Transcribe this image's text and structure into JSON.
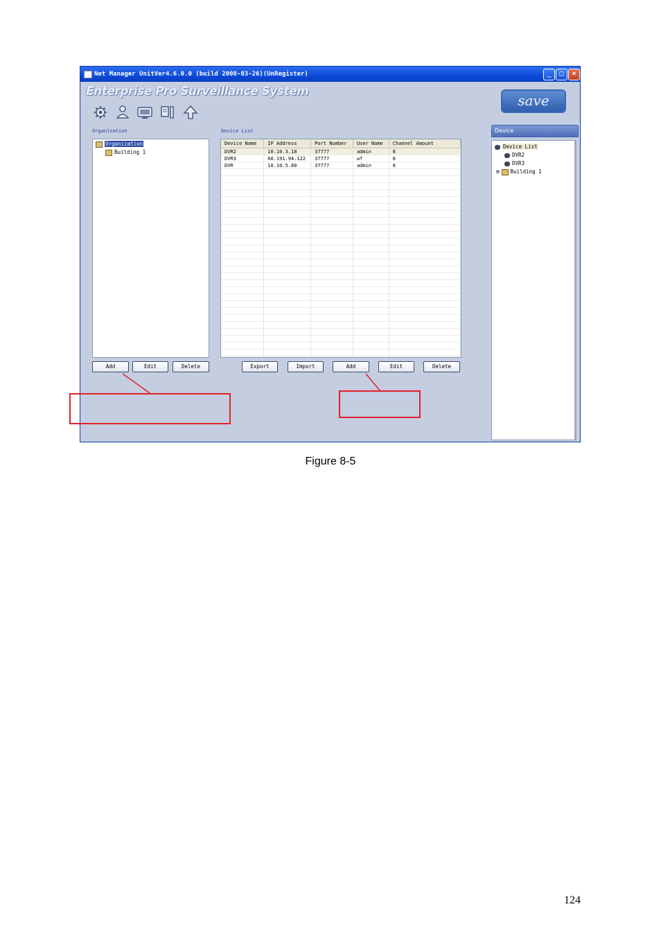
{
  "window": {
    "title": "Net Manager UnitVer4.6.0.0 (build 2008-03-26)(UnRegister)",
    "brand": "Enterprise Pro Surveillance System",
    "save_label": "save",
    "controls": {
      "minimize": "_",
      "maximize": "□",
      "close": "×"
    }
  },
  "toolbar": {
    "icons": [
      "gear-icon",
      "user-icon",
      "monitor-icon",
      "config-icon",
      "up-arrow-icon"
    ]
  },
  "organization": {
    "label": "Organization",
    "tree": [
      "Organization",
      "Building 1"
    ],
    "buttons": [
      "Add",
      "Edit",
      "Delete"
    ]
  },
  "device_list": {
    "label": "Device List",
    "columns": [
      "Device Name",
      "IP Address",
      "Port Number",
      "User Name",
      "Channel Amount"
    ],
    "rows": [
      [
        "DVR2",
        "10.10.3.18",
        "37777",
        "admin",
        "8"
      ],
      [
        "DVR3",
        "60.191.94.122",
        "37777",
        "wf",
        "8"
      ],
      [
        "DVR",
        "10.10.5.80",
        "37777",
        "admin",
        "8"
      ]
    ],
    "buttons": [
      "Export",
      "Import",
      "Add",
      "Edit",
      "Delete"
    ]
  },
  "device_panel": {
    "header": "Device",
    "tree": [
      "Device List",
      "DVR2",
      "DVR3",
      "Building 1"
    ],
    "expander": "⊞"
  },
  "colors": {
    "window_bg": "#c4cee0",
    "titlebar": "#0a4ad8",
    "highlight_box": "#e2202a"
  },
  "caption": "Figure 8-5",
  "page_number": "124"
}
